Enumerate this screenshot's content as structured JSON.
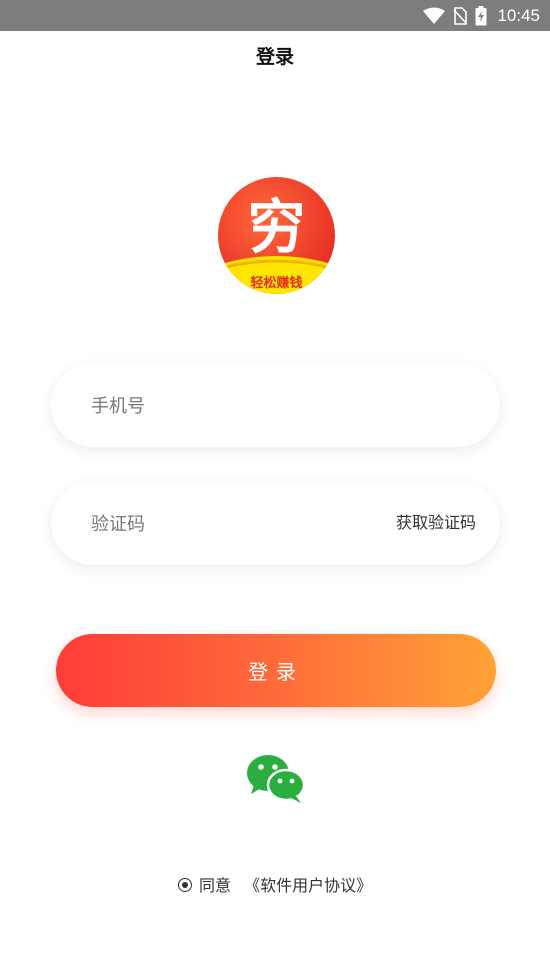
{
  "status_bar": {
    "time": "10:45",
    "icons": [
      "wifi-icon",
      "sim-no-signal-icon",
      "battery-charging-icon"
    ]
  },
  "header": {
    "title": "登录"
  },
  "logo": {
    "main_char": "穷",
    "slogan": "轻松赚钱"
  },
  "form": {
    "phone_placeholder": "手机号",
    "code_placeholder": "验证码",
    "get_code_label": "获取验证码",
    "login_label": "登录"
  },
  "colors": {
    "gradient_start": "#ff3b38",
    "gradient_end": "#ffa336",
    "wechat_green": "#2aae3d"
  },
  "wechat": {
    "icon": "wechat-icon"
  },
  "agreement": {
    "agree_label": "同意",
    "link_label": "《软件用户协议》"
  }
}
